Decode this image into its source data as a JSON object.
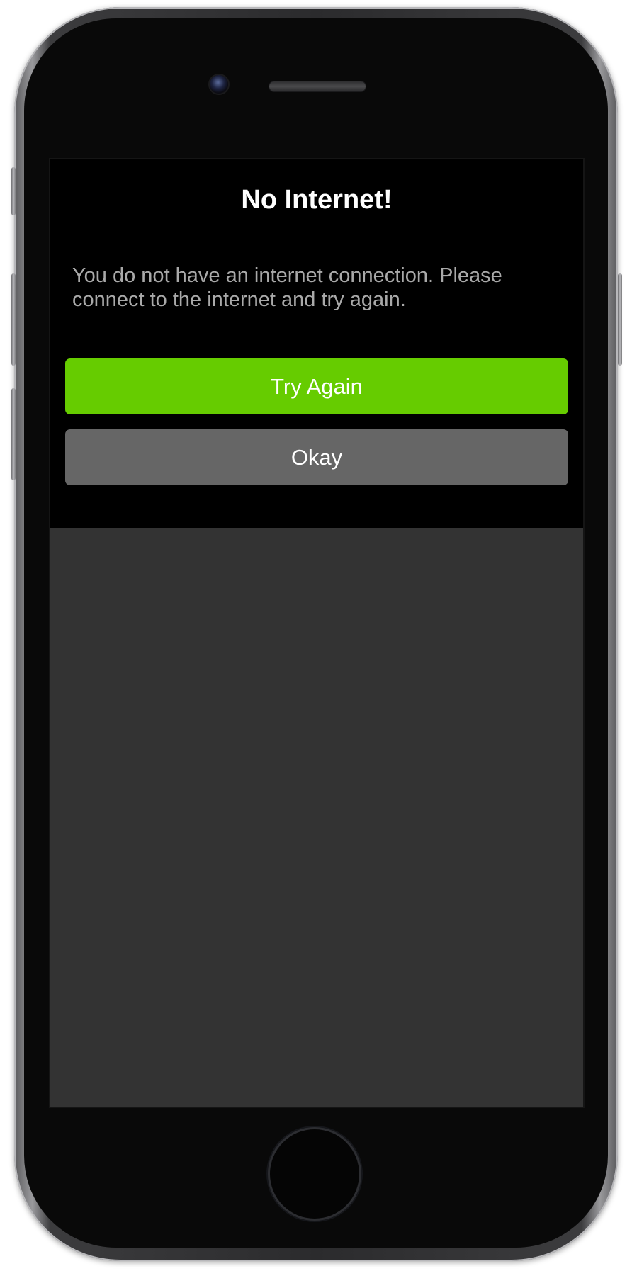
{
  "dialog": {
    "title": "No Internet!",
    "message": "You do not have an internet connection. Please connect to the internet and try again.",
    "primary_button_label": "Try Again",
    "secondary_button_label": "Okay"
  },
  "colors": {
    "primary_button": "#66cc00",
    "secondary_button": "#666666",
    "dialog_background": "#000000",
    "screen_background": "#333333",
    "message_text": "#a9a9a9"
  },
  "icons": [
    "front-camera-icon",
    "earpiece-speaker-icon",
    "home-button-icon"
  ]
}
